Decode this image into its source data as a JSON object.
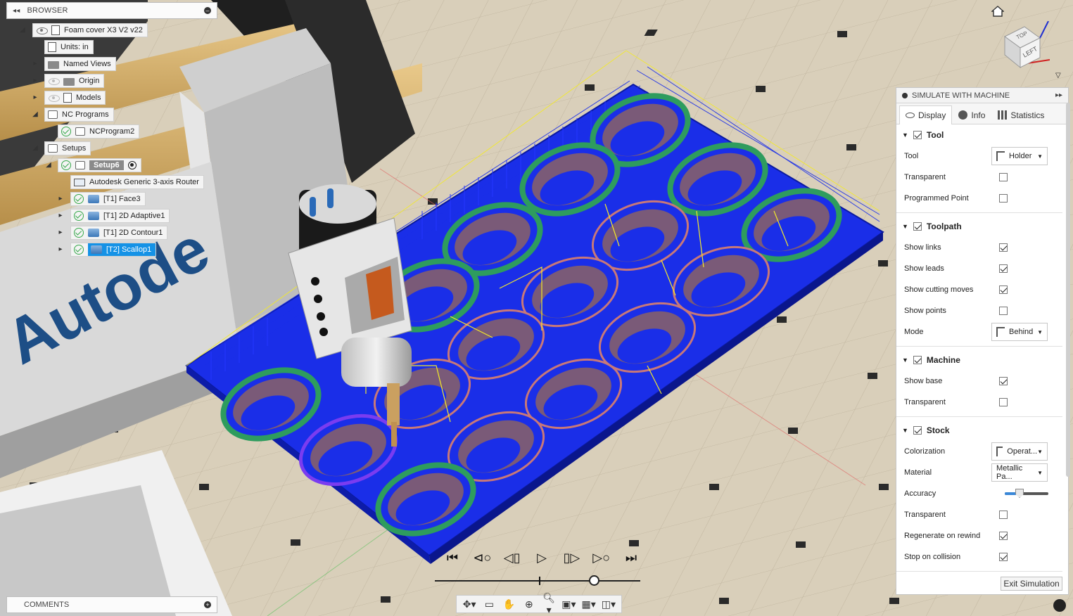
{
  "browser": {
    "title": "BROWSER",
    "document_name": "Foam cover X3 V2 v22",
    "units_label": "Units: in",
    "named_views": "Named Views",
    "origin": "Origin",
    "models": "Models",
    "nc_programs": "NC Programs",
    "nc_program_1": "NCProgram2",
    "setups": "Setups",
    "setup_6": "Setup6",
    "machine": "Autodesk Generic 3-axis Router",
    "operations": [
      "[T1] Face3",
      "[T1] 2D Adaptive1",
      "[T1] 2D Contour1",
      "[T2] Scallop1"
    ]
  },
  "comments": {
    "label": "COMMENTS"
  },
  "simulate": {
    "title": "SIMULATE WITH MACHINE",
    "tabs": [
      "Display",
      "Info",
      "Statistics"
    ],
    "active_tab": "Display",
    "sections": {
      "tool": {
        "title": "Tool",
        "checked": true,
        "tool_label": "Tool",
        "tool_value": "Holder",
        "transparent_label": "Transparent",
        "transparent": false,
        "programmed_point_label": "Programmed Point",
        "programmed_point": false
      },
      "toolpath": {
        "title": "Toolpath",
        "checked": true,
        "show_links_label": "Show links",
        "show_leads_label": "Show leads",
        "show_cutting_moves_label": "Show cutting moves",
        "show_points_label": "Show points",
        "mode_label": "Mode",
        "mode_value": "Behind"
      },
      "machine": {
        "title": "Machine",
        "checked": true,
        "show_base_label": "Show base",
        "transparent_label": "Transparent"
      },
      "stock": {
        "title": "Stock",
        "checked": true,
        "colorization_label": "Colorization",
        "colorization_value": "Operat...",
        "material_label": "Material",
        "material_value": "Metallic Pa...",
        "accuracy_label": "Accuracy",
        "transparent_label": "Transparent",
        "regenerate_label": "Regenerate on rewind",
        "stop_collision_label": "Stop on collision"
      }
    },
    "exit_label": "Exit Simulation"
  },
  "viewcube": {
    "top": "TOP",
    "left": "LEFT"
  },
  "machine_brand_text": "Autode",
  "colors": {
    "stock_blue": "#1a2ee8",
    "toolpath_yellow": "#f3ea2a",
    "highlight": "#1592e6",
    "floor": "#d8cdb8"
  }
}
